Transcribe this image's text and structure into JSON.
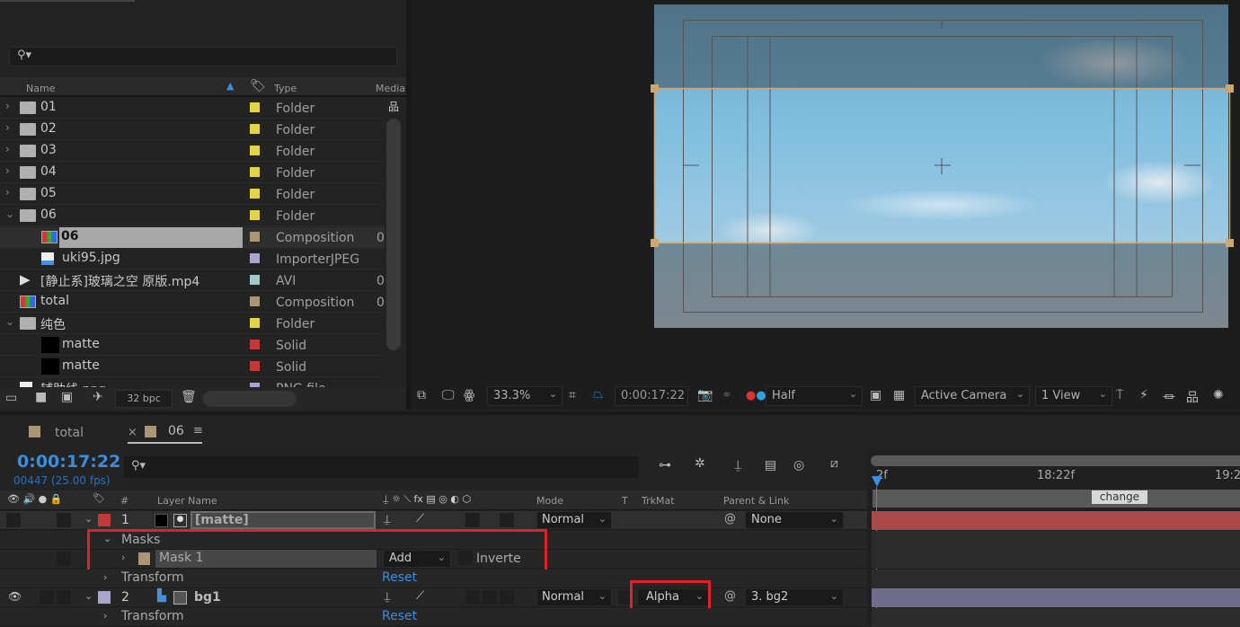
{
  "project": {
    "columns": {
      "name": "Name",
      "type": "Type",
      "media": "Media"
    },
    "items": [
      {
        "name": "01",
        "type": "Folder",
        "label": "#e2d448",
        "kind": "folder",
        "expanded": false
      },
      {
        "name": "02",
        "type": "Folder",
        "label": "#e2d448",
        "kind": "folder",
        "expanded": false
      },
      {
        "name": "03",
        "type": "Folder",
        "label": "#e2d448",
        "kind": "folder",
        "expanded": false
      },
      {
        "name": "04",
        "type": "Folder",
        "label": "#e2d448",
        "kind": "folder",
        "expanded": false
      },
      {
        "name": "05",
        "type": "Folder",
        "label": "#e2d448",
        "kind": "folder",
        "expanded": false
      },
      {
        "name": "06",
        "type": "Folder",
        "label": "#e2d448",
        "kind": "folder",
        "expanded": true
      },
      {
        "name": "06",
        "type": "Composition",
        "label": "#a89676",
        "kind": "comp",
        "media": "0",
        "selected": true,
        "indent": 1
      },
      {
        "name": "uki95.jpg",
        "type": "ImporterJPEG",
        "label": "#a8a6cc",
        "kind": "image",
        "indent": 1
      },
      {
        "name": "[静止系]玻璃之空 原版.mp4",
        "type": "AVI",
        "label": "#a6c8c8",
        "kind": "video",
        "media": "0"
      },
      {
        "name": "total",
        "type": "Composition",
        "label": "#a89676",
        "kind": "comp",
        "media": "0"
      },
      {
        "name": "纯色",
        "type": "Folder",
        "label": "#e2d448",
        "kind": "folder",
        "expanded": true
      },
      {
        "name": "matte",
        "type": "Solid",
        "label": "#c03a3a",
        "kind": "solid",
        "indent": 1
      },
      {
        "name": "matte",
        "type": "Solid",
        "label": "#c03a3a",
        "kind": "solid",
        "indent": 1
      },
      {
        "name": "辅助线.png",
        "type": "PNG file",
        "label": "#a8a6cc",
        "kind": "image"
      }
    ],
    "bpc": "32 bpc"
  },
  "viewer": {
    "zoom": "33.3%",
    "timecode": "0:00:17:22",
    "resolution": "Half",
    "camera": "Active Camera",
    "views": "1 View"
  },
  "timeline": {
    "tabs": [
      {
        "label": "total",
        "color": "#a89676"
      },
      {
        "label": "06",
        "color": "#a89676",
        "active": true
      }
    ],
    "timecode": "0:00:17:22",
    "frames": "00447 (25.00 fps)",
    "headers": {
      "num": "#",
      "layer_name": "Layer Name",
      "mode": "Mode",
      "t": "T",
      "trkmat": "TrkMat",
      "parent": "Parent & Link"
    },
    "ruler": [
      "2f",
      "18:22f",
      "19:2"
    ],
    "marker": "change",
    "layers": [
      {
        "num": "1",
        "name": "[matte]",
        "label": "#c03a3a",
        "mode": "Normal",
        "parent": "None",
        "bar": "#a84848"
      },
      {
        "num": "2",
        "name": "bg1",
        "label": "#a8a6cc",
        "mode": "Normal",
        "trkmat": "Alpha",
        "parent": "3. bg2",
        "bar": "#706c8c"
      }
    ],
    "masks": {
      "label": "Masks",
      "mask_name": "Mask 1",
      "mask_color": "#a89676",
      "mode": "Add",
      "inverted": "Inverte"
    },
    "transform": "Transform",
    "reset": "Reset",
    "accent": "#3b8de0",
    "highlight": "#e0202a"
  }
}
